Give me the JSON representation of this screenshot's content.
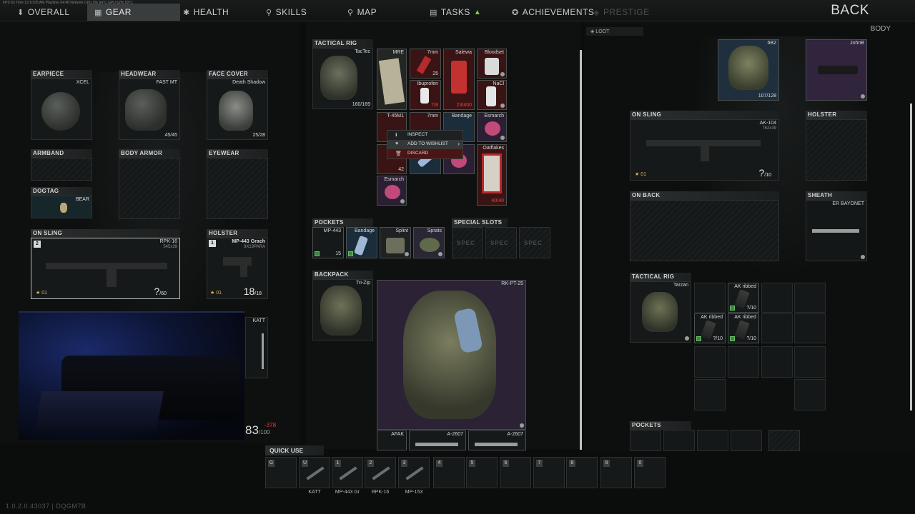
{
  "perf_text": "FPS 63   Time 12:10:05 AM   Playtime 04:48   Network   CPU 9%   64°C   GPU 62%   50°C",
  "nav": {
    "overall": "OVERALL",
    "gear": "GEAR",
    "health": "HEALTH",
    "skills": "SKILLS",
    "map": "MAP",
    "tasks": "TASKS",
    "achievements": "ACHIEVEMENTS",
    "prestige": "PRESTIGE",
    "back": "BACK",
    "loot": "LOOT",
    "body": "BODY"
  },
  "left": {
    "earpiece": {
      "title": "EARPIECE",
      "item": "XCEL"
    },
    "headwear": {
      "title": "HEADWEAR",
      "item": "FAST MT",
      "count": "45/45"
    },
    "face_cover": {
      "title": "FACE COVER",
      "item": "Death Shadow",
      "count": "25/28"
    },
    "armband": {
      "title": "ARMBAND"
    },
    "body_armor": {
      "title": "BODY ARMOR"
    },
    "eyewear": {
      "title": "EYEWEAR"
    },
    "dogtag": {
      "title": "DOGTAG",
      "item": "BEAR"
    },
    "on_sling": {
      "title": "ON SLING",
      "item": "RPK-16",
      "caliber": "545x39",
      "hotkey": "2",
      "ammo": "?",
      "ammo_max": "/60",
      "mode": "01"
    },
    "holster": {
      "title": "HOLSTER",
      "item": "MP-443 Grach",
      "caliber": "9X19PARA",
      "hotkey": "1",
      "ammo": "18",
      "ammo_max": "/18",
      "mode": "01"
    },
    "sheath_item": "KATT"
  },
  "center": {
    "tactical_rig": {
      "title": "TACTICAL RIG",
      "item": "TacTec",
      "count": "160/169"
    },
    "rig_items": [
      {
        "name": "MRE",
        "count": ""
      },
      {
        "name": "7mm",
        "count": "25"
      },
      {
        "name": "Salewa",
        "count": "23/400"
      },
      {
        "name": "Bloodset",
        "count": ""
      },
      {
        "name": "Ibuprofen",
        "count": "7/8"
      },
      {
        "name": "NaCl",
        "count": ""
      },
      {
        "name": "T-45M1",
        "count": ""
      },
      {
        "name": "7mm",
        "count": ""
      },
      {
        "name": "Bandage",
        "count": ""
      },
      {
        "name": "Esmarch",
        "count": ""
      },
      {
        "name": "42",
        "count": ""
      },
      {
        "name": "Esmarch",
        "count": ""
      },
      {
        "name": "Oatflakes",
        "count": "40/40"
      }
    ],
    "context_menu": [
      {
        "icon": "ℹ",
        "label": "INSPECT"
      },
      {
        "icon": "♥",
        "label": "ADD TO WISHLIST"
      },
      {
        "icon": "🗑",
        "label": "DISCARD"
      }
    ],
    "pockets": {
      "title": "POCKETS",
      "items": [
        {
          "name": "MP-443",
          "count": "15"
        },
        {
          "name": "Bandage",
          "count": ""
        },
        {
          "name": "Splint",
          "count": ""
        },
        {
          "name": "Sprats",
          "count": ""
        }
      ]
    },
    "special": {
      "title": "SPECIAL SLOTS",
      "slots": [
        "SPEC",
        "SPEC",
        "SPEC"
      ]
    },
    "backpack": {
      "title": "BACKPACK",
      "item": "Tri-Zip",
      "inner_item": "RK-PT-25",
      "bottom_items": [
        {
          "name": "AFAK"
        },
        {
          "name": "A-2607"
        },
        {
          "name": "A-2607"
        }
      ]
    }
  },
  "right": {
    "body_armor_item": {
      "name": "6B2",
      "count": "107/128"
    },
    "johnb_item": {
      "name": "JohnB"
    },
    "on_sling": {
      "title": "ON SLING",
      "item": "AK-104",
      "caliber": "762x39",
      "ammo": "?",
      "ammo_max": "/10",
      "mode": "01"
    },
    "holster": {
      "title": "HOLSTER"
    },
    "on_back": {
      "title": "ON BACK"
    },
    "sheath": {
      "title": "SHEATH",
      "item": "ER BAYONET"
    },
    "tactical_rig": {
      "title": "TACTICAL RIG",
      "item": "Tarzan"
    },
    "mags": [
      {
        "name": "AK ribbed",
        "count": "?/10"
      },
      {
        "name": "AK ribbed",
        "count": "?/10"
      },
      {
        "name": "AK ribbed",
        "count": "?/10"
      }
    ],
    "pockets": {
      "title": "POCKETS"
    }
  },
  "health": {
    "value": "83",
    "max": "/100",
    "delta": "-378"
  },
  "quick_use": {
    "title": "QUICK USE",
    "slots": [
      {
        "key": "G",
        "label": ""
      },
      {
        "key": "U",
        "label": "KATT"
      },
      {
        "key": "1",
        "label": "MP-443 Gr"
      },
      {
        "key": "2",
        "label": "RPK-16"
      },
      {
        "key": "3",
        "label": "MP-153"
      },
      {
        "key": "4",
        "label": ""
      },
      {
        "key": "5",
        "label": ""
      },
      {
        "key": "6",
        "label": ""
      },
      {
        "key": "7",
        "label": ""
      },
      {
        "key": "8",
        "label": ""
      },
      {
        "key": "9",
        "label": ""
      },
      {
        "key": "0",
        "label": ""
      }
    ]
  },
  "version": "1.0.2.0.43037 | DQGM7B",
  "colors": {
    "accent_green": "#3c8a3c",
    "danger": "#4a1515",
    "red_text": "#e04545"
  }
}
